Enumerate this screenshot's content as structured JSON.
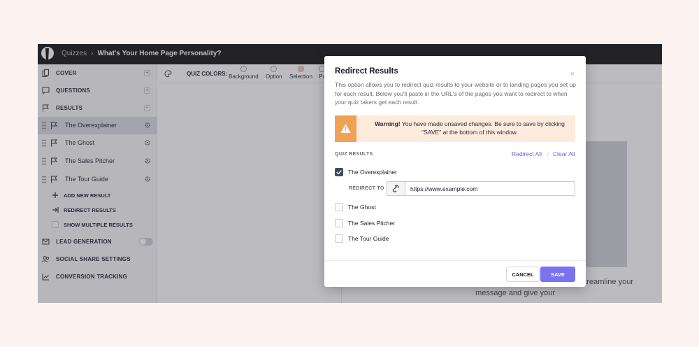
{
  "colors": {
    "accent": "#7b72f0",
    "link": "#6e63e0",
    "warning": "#f0a153",
    "warning_bg": "#fdebdd",
    "topbar": "#111111"
  },
  "header": {
    "breadcrumb_root": "Quizzes",
    "separator": "›",
    "title": "What's Your Home Page Personality?"
  },
  "sidebar": {
    "items": [
      {
        "label": "COVER",
        "icon": "copy-icon"
      },
      {
        "label": "QUESTIONS",
        "icon": "chat-icon"
      },
      {
        "label": "RESULTS",
        "icon": "flag-icon"
      }
    ],
    "results": [
      {
        "label": "The Overexplainer",
        "active": true
      },
      {
        "label": "The Ghost",
        "active": false
      },
      {
        "label": "The Sales Pitcher",
        "active": false
      },
      {
        "label": "The Tour Guide",
        "active": false
      }
    ],
    "add_new_result": "ADD NEW RESULT",
    "redirect_results": "REDIRECT RESULTS",
    "show_multiple_results": "SHOW MULTIPLE RESULTS",
    "lead_generation": "LEAD GENERATION",
    "social_share": "SOCIAL SHARE SETTINGS",
    "conversion_tracking": "CONVERSION TRACKING"
  },
  "colorbar": {
    "title": "QUIZ COLORS:",
    "swatches": [
      {
        "label": "Background",
        "color": "#ffffff"
      },
      {
        "label": "Option",
        "color": "#ffffff"
      },
      {
        "label": "Selection",
        "color": "#f4c6c6"
      },
      {
        "label": "Pr",
        "color": "#ffffff"
      }
    ]
  },
  "preview": {
    "text": "e info — which is great — but it's overwhelming. Let's streamline your message and give your"
  },
  "modal": {
    "title": "Redirect Results",
    "close": "×",
    "description": "This option allows you to redirect quiz results to your website or to landing pages you set up for each result. Below you'll paste in the URL's of the pages you want to redirect to when your quiz takers get each result.",
    "warning_bold": "Warning!",
    "warning_text": " You have made unsaved changes. Be sure to save by clicking \"SAVE\" at the bottom of this window.",
    "quiz_results_label": "QUIZ RESULTS",
    "redirect_all": "Redirect All",
    "link_separator": "/",
    "clear_all": "Clear All",
    "results": [
      {
        "label": "The Overexplainer",
        "checked": true
      },
      {
        "label": "The Ghost",
        "checked": false
      },
      {
        "label": "The Sales Pitcher",
        "checked": false
      },
      {
        "label": "The Tour Guide",
        "checked": false
      }
    ],
    "redirect_to_label": "REDIRECT TO",
    "url_value": "https://www.example.com",
    "cancel": "CANCEL",
    "save": "SAVE"
  }
}
